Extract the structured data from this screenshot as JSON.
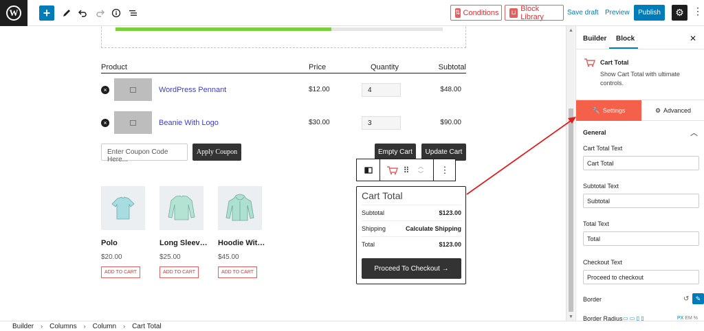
{
  "toolbar": {
    "add_icon": "plus-icon",
    "conditions_label": "Conditions",
    "block_library_label": "Block Library",
    "save_draft_label": "Save draft",
    "preview_label": "Preview",
    "publish_label": "Publish",
    "accent_color": "#007cba",
    "brand_color": "#e26060"
  },
  "progress": {
    "fraction": 0.66,
    "color": "#7ad03a"
  },
  "cart": {
    "headers": [
      "Product",
      "Price",
      "Quantity",
      "Subtotal"
    ],
    "rows": [
      {
        "name": "WordPress Pennant",
        "price": "$12.00",
        "qty": "4",
        "subtotal": "$48.00"
      },
      {
        "name": "Beanie With Logo",
        "price": "$30.00",
        "qty": "3",
        "subtotal": "$90.00"
      }
    ],
    "coupon_placeholder": "Enter Coupon Code Here...",
    "apply_label": "Apply Coupon",
    "empty_label": "Empty Cart",
    "update_label": "Update Cart"
  },
  "products": [
    {
      "title": "Polo",
      "price": "$20.00",
      "button": "ADD TO CART",
      "icon": "polo-shirt-icon"
    },
    {
      "title": "Long Sleev…",
      "price": "$25.00",
      "button": "ADD TO CART",
      "icon": "long-sleeve-shirt-icon"
    },
    {
      "title": "Hoodie Wit…",
      "price": "$45.00",
      "button": "ADD TO CART",
      "icon": "hoodie-icon"
    }
  ],
  "cart_total": {
    "title": "Cart Total",
    "subtotal_label": "Subtotal",
    "subtotal_value": "$123.00",
    "shipping_label": "Shipping",
    "shipping_value": "Calculate Shipping",
    "total_label": "Total",
    "total_value": "$123.00",
    "checkout_label": "Proceed To Checkout →"
  },
  "sidebar": {
    "tab_builder": "Builder",
    "tab_block": "Block",
    "block_name": "Cart Total",
    "block_desc": "Show Cart Total with ultimate controls.",
    "settings_tab": "Settings",
    "advanced_tab": "Advanced",
    "section": "General",
    "fields": [
      {
        "label": "Cart Total Text",
        "value": "Cart Total"
      },
      {
        "label": "Subtotal Text",
        "value": "Subtotal"
      },
      {
        "label": "Total Text",
        "value": "Total"
      },
      {
        "label": "Checkout Text",
        "value": "Proceed to checkout"
      }
    ],
    "border_label": "Border",
    "border_radius_label": "Border Radius",
    "units": [
      "PX",
      "EM",
      "%"
    ]
  },
  "breadcrumb": [
    "Builder",
    "Columns",
    "Column",
    "Cart Total"
  ]
}
